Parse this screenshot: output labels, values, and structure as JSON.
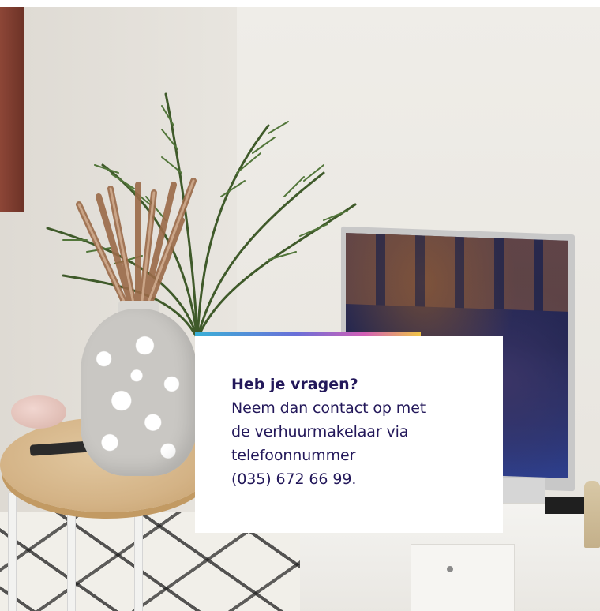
{
  "contact_card": {
    "heading": "Heb je vragen?",
    "body_lines": [
      "Neem dan contact op met",
      "de verhuurmakelaar via",
      "telefoonnummer",
      "(035) 672 66 99."
    ]
  },
  "colors": {
    "card_text": "#23185a",
    "card_background": "#ffffff",
    "accent_gradient": [
      "#3ab0d7",
      "#6a6fd8",
      "#d25fb6",
      "#f0c545"
    ]
  }
}
